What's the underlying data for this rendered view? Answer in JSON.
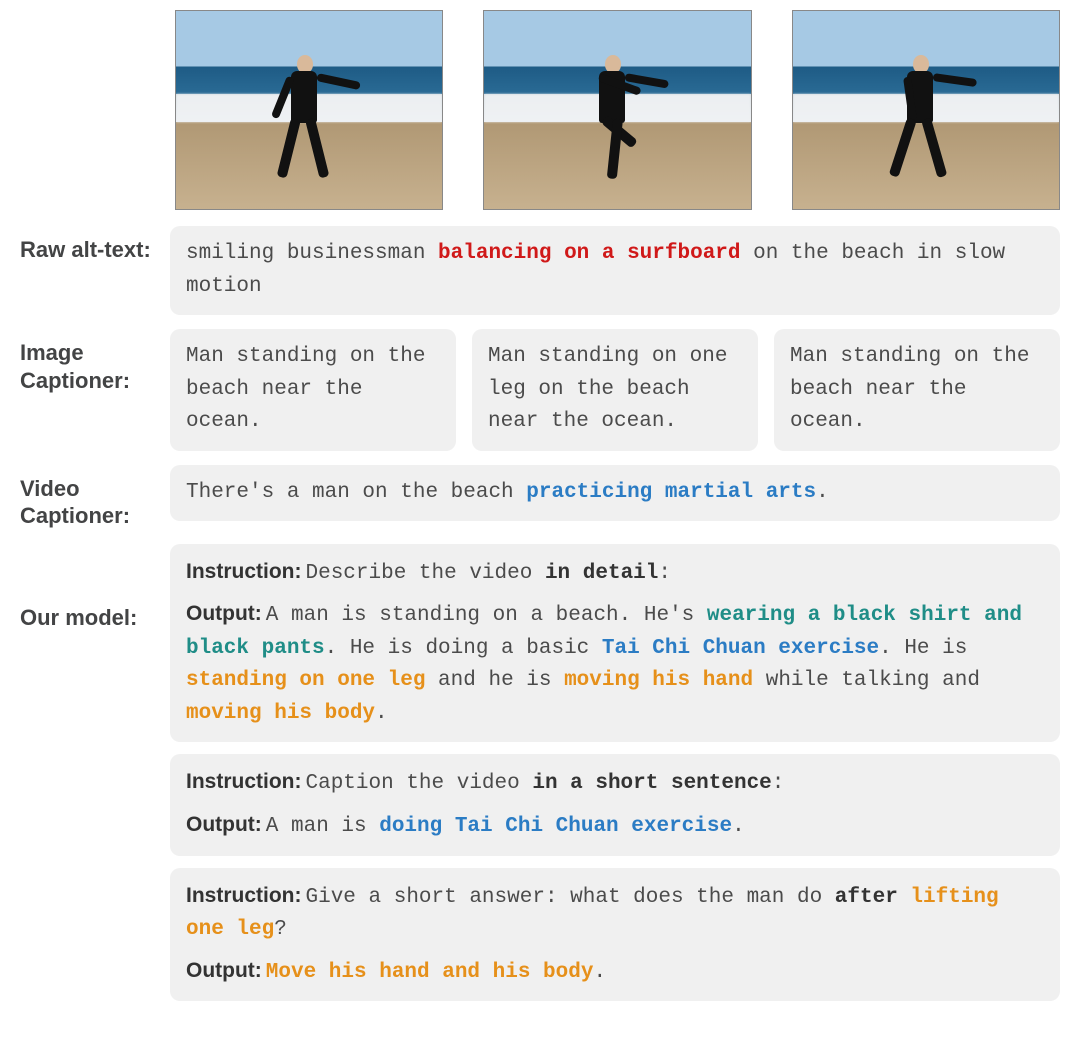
{
  "labels": {
    "raw_alt_text": "Raw alt-text",
    "image_captioner": "Image Captioner",
    "video_captioner": "Video Captioner",
    "our_model": "Our model",
    "instruction": "Instruction:",
    "output": "Output:"
  },
  "raw_alt": {
    "pre": "smiling businessman ",
    "highlight": "balancing on a surfboard",
    "post": " on the beach in slow motion"
  },
  "image_captions": {
    "c1": "Man standing on the beach near the ocean.",
    "c2": "Man standing on one leg on the beach near the ocean.",
    "c3": "Man standing on the beach near the ocean."
  },
  "video_caption": {
    "pre": "There's a man on the beach ",
    "highlight": "practicing martial arts",
    "post": "."
  },
  "our_model": {
    "ex1": {
      "inst_pre": "Describe the video ",
      "inst_bold": "in detail",
      "inst_post": ":",
      "out": {
        "s1": "A man is standing on a beach. He's ",
        "teal1": "wearing a black shirt and black pants",
        "s2": ". He is doing a basic ",
        "blue1": "Tai Chi Chuan exercise",
        "s3": ". He is ",
        "orange1": "standing on one leg",
        "s4": " and he is ",
        "orange2": "moving his hand",
        "s5": " while talking and ",
        "orange3": "moving his body",
        "s6": "."
      }
    },
    "ex2": {
      "inst_pre": "Caption the video ",
      "inst_bold": "in a short sentence",
      "inst_post": ":",
      "out_pre": "A man is ",
      "out_blue": "doing Tai Chi Chuan exercise",
      "out_post": "."
    },
    "ex3": {
      "inst_pre": "Give a short answer: what does the man do ",
      "inst_bold": "after ",
      "inst_orange": "lifting one leg",
      "inst_post": "?",
      "out_orange": "Move his hand and his body",
      "out_post": "."
    }
  }
}
